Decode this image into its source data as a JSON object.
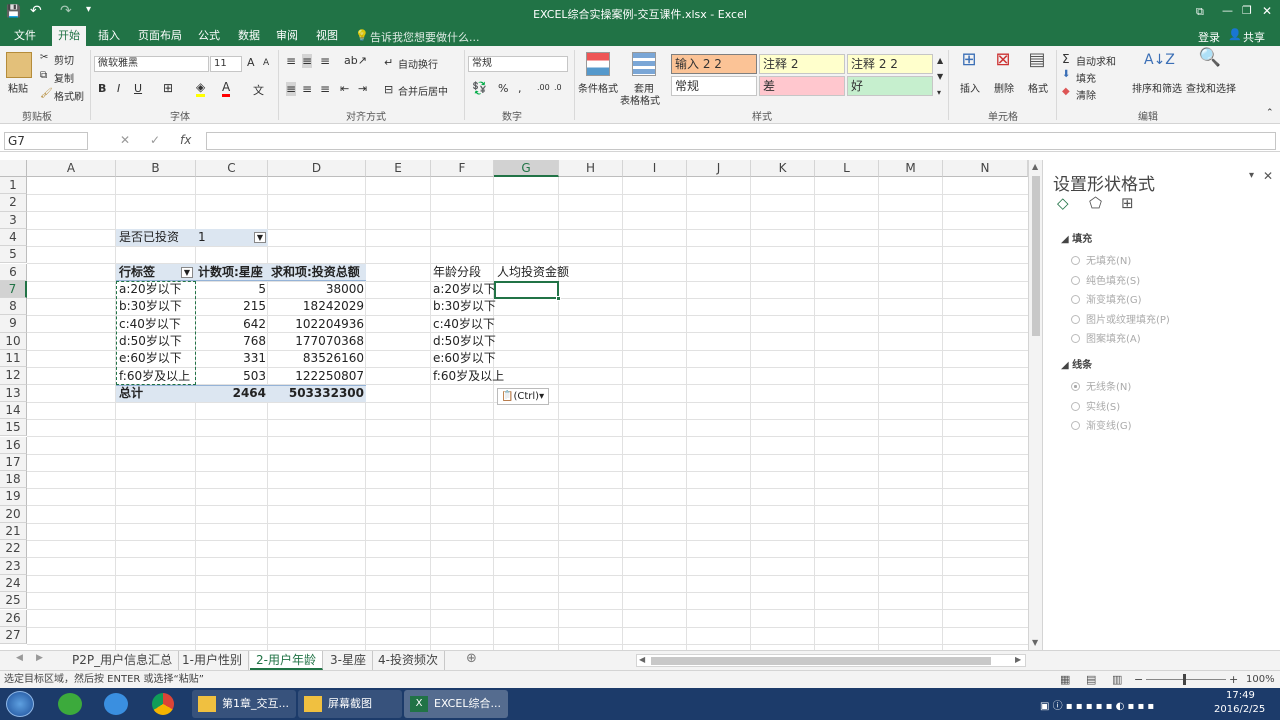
{
  "window": {
    "title": "EXCEL综合实操案例-交互课件.xlsx - Excel",
    "controls": {
      "ribbon_display": "⧉",
      "minimize": "—",
      "restore": "❐",
      "close": "✕"
    },
    "qat": {
      "save": "💾",
      "undo": "↶",
      "redo": "↷",
      "more": "▾"
    }
  },
  "ribbon_tabs": [
    "文件",
    "开始",
    "插入",
    "页面布局",
    "公式",
    "数据",
    "审阅",
    "视图"
  ],
  "tell_me": "告诉我您想要做什么...",
  "account": {
    "signin": "登录",
    "share": "共享"
  },
  "ribbon": {
    "clipboard": {
      "paste": "粘贴",
      "cut": "剪切",
      "copy": "复制",
      "format_painter": "格式刷",
      "label": "剪贴板"
    },
    "font": {
      "name": "微软雅黑",
      "size": "11",
      "label": "字体",
      "bold": "B",
      "italic": "I",
      "underline": "U",
      "grow": "A",
      "shrink": "A",
      "font_color_letter": "A",
      "wen": "文"
    },
    "alignment": {
      "wrap": "自动换行",
      "merge": "合并后居中",
      "label": "对齐方式"
    },
    "number": {
      "format": "常规",
      "percent": "%",
      "comma": ",",
      "label": "数字",
      "inc": ".00",
      "dec": ".0"
    },
    "styles": {
      "cond": "条件格式",
      "table1": "套用",
      "table2": "表格格式",
      "cells": [
        {
          "text": "输入 2 2",
          "bg": "#fbc396"
        },
        {
          "text": "注释 2",
          "bg": "#ffffcc"
        },
        {
          "text": "注释 2 2",
          "bg": "#ffffcc"
        },
        {
          "text": "常规",
          "bg": "#ffffff"
        },
        {
          "text": "差",
          "bg": "#ffc7ce"
        },
        {
          "text": "好",
          "bg": "#c6efce"
        }
      ],
      "label": "样式"
    },
    "cells": {
      "insert": "插入",
      "delete": "删除",
      "format": "格式",
      "label": "单元格"
    },
    "editing": {
      "autosum": "自动求和",
      "fill": "填充",
      "clear": "清除",
      "sort": "排序和筛选",
      "find": "查找和选择",
      "label": "编辑"
    }
  },
  "formula_bar": {
    "name_box": "G7",
    "fx": "fx",
    "cancel": "✕",
    "enter": "✓",
    "value": ""
  },
  "grid": {
    "columns": [
      "A",
      "B",
      "C",
      "D",
      "E",
      "F",
      "G",
      "H",
      "I",
      "J",
      "K",
      "L",
      "M",
      "N"
    ],
    "rows": [
      "1",
      "2",
      "3",
      "4",
      "5",
      "6",
      "7",
      "8",
      "9",
      "10",
      "11",
      "12",
      "13",
      "14",
      "15",
      "16",
      "17",
      "18",
      "19",
      "20",
      "21",
      "22",
      "23",
      "24",
      "25",
      "26",
      "27"
    ],
    "filter": {
      "label": "是否已投资",
      "value": "1"
    },
    "pivot_headers": [
      "行标签",
      "计数项:星座",
      "求和项:投资总额"
    ],
    "pivot_rows": [
      [
        "a:20岁以下",
        "5",
        "38000"
      ],
      [
        "b:30岁以下",
        "215",
        "18242029"
      ],
      [
        "c:40岁以下",
        "642",
        "102204936"
      ],
      [
        "d:50岁以下",
        "768",
        "177070368"
      ],
      [
        "e:60岁以下",
        "331",
        "83526160"
      ],
      [
        "f:60岁及以上",
        "503",
        "122250807"
      ]
    ],
    "pivot_total": [
      "总计",
      "2464",
      "503332300"
    ],
    "side_headers": [
      "年龄分段",
      "人均投资金额"
    ],
    "side_rows": [
      "a:20岁以下",
      "b:30岁以下",
      "c:40岁以下",
      "d:50岁以下",
      "e:60岁以下",
      "f:60岁及以上"
    ],
    "paste_ctrl": "(Ctrl)"
  },
  "format_pane": {
    "title": "设置形状格式",
    "fill_section": "填充",
    "fill_options": [
      "无填充(N)",
      "纯色填充(S)",
      "渐变填充(G)",
      "图片或纹理填充(P)",
      "图案填充(A)"
    ],
    "line_section": "线条",
    "line_options": [
      "无线条(N)",
      "实线(S)",
      "渐变线(G)"
    ],
    "close": "✕",
    "menu": "▾"
  },
  "sheet_tabs": [
    "P2P_用户信息汇总",
    "1-用户性别",
    "2-用户年龄",
    "3-星座",
    "4-投资频次"
  ],
  "active_sheet": "2-用户年龄",
  "status": {
    "message": "选定目标区域，然后按 ENTER 或选择“粘贴”",
    "zoom": "100%"
  },
  "taskbar": {
    "items": [
      "第1章_交互...",
      "屏幕截图",
      "EXCEL综合..."
    ],
    "time": "17:49",
    "date": "2016/2/25"
  }
}
